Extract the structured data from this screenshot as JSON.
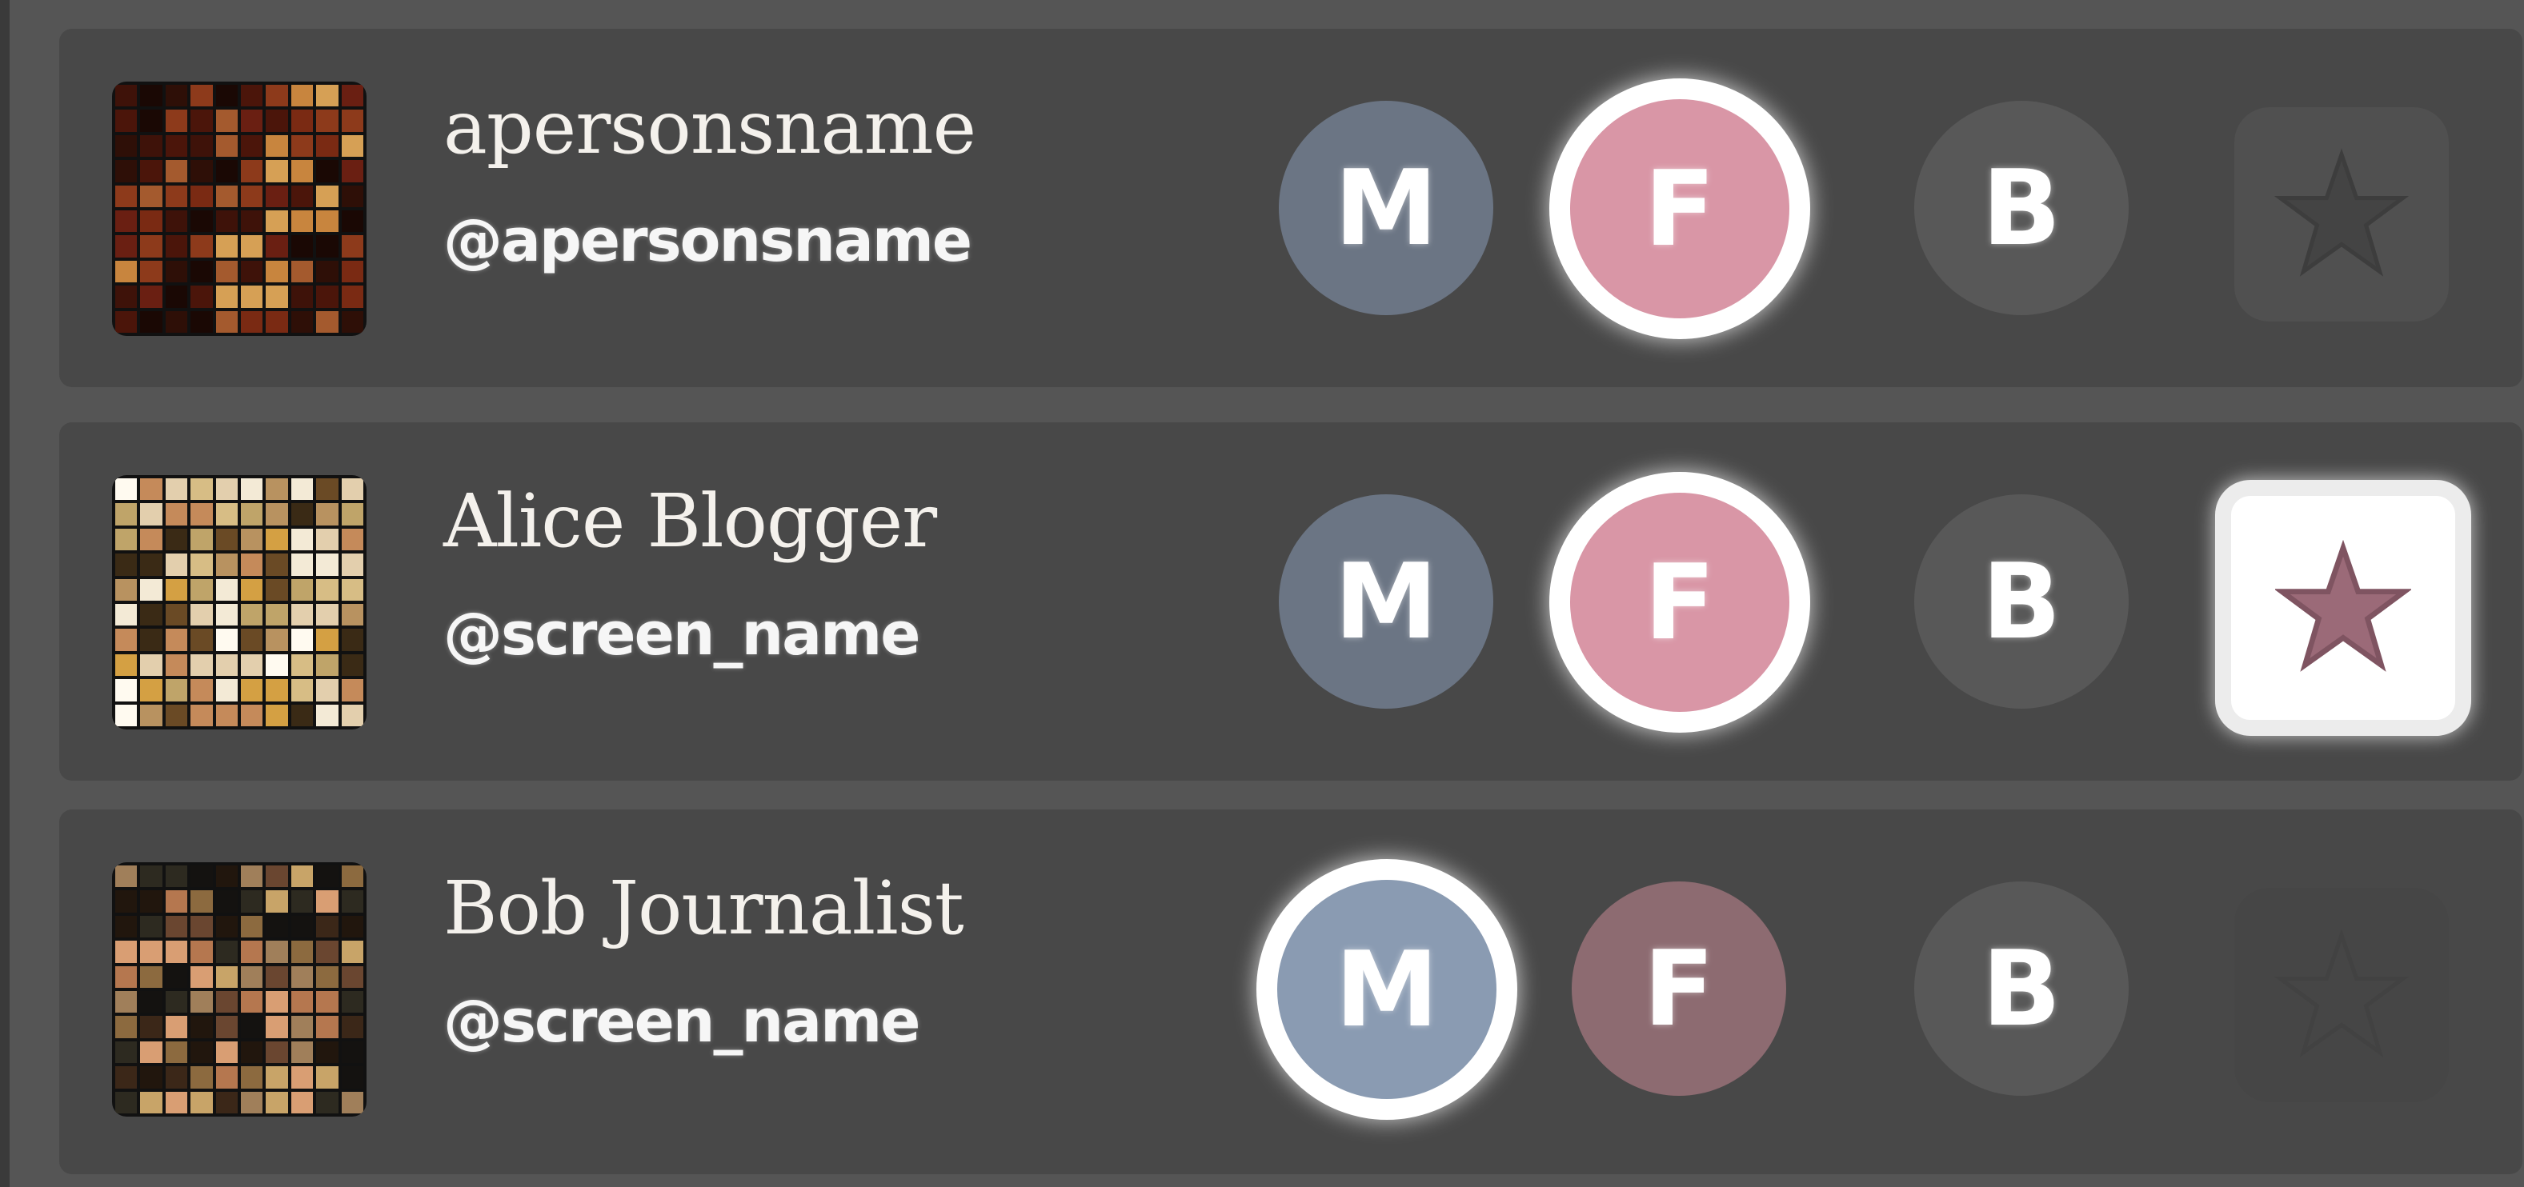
{
  "colors": {
    "male_active": "#8a9bb2",
    "male_inactive": "#6b7584",
    "female_active": "#d996a6",
    "female_inactive": "#8d6b71",
    "both_inactive": "#585858",
    "star_off": "#444444",
    "star_on": "#9b6a78",
    "row_bg": "#484848"
  },
  "accounts": [
    {
      "name": "apersonsname",
      "handle": "@apersonsname",
      "gender_buttons": {
        "m": "M",
        "f": "F",
        "b": "B"
      },
      "selected": "F",
      "favorite": "partially visible",
      "avatar_palette": [
        "#2e0f07",
        "#4b150a",
        "#6a1f12",
        "#8d3a1b",
        "#a45a2e",
        "#c8853e",
        "#d6a055",
        "#7a2a13",
        "#3e1209",
        "#1a0804"
      ]
    },
    {
      "name": "Alice Blogger",
      "handle": "@screen_name",
      "gender_buttons": {
        "m": "M",
        "f": "F",
        "b": "B"
      },
      "selected": "F",
      "favorite": "on",
      "avatar_palette": [
        "#bfa469",
        "#d7bd85",
        "#3a2a15",
        "#c58a5a",
        "#e3cfad",
        "#f3ead6",
        "#d4a043",
        "#6a4a25",
        "#b89260",
        "#fffaf0"
      ]
    },
    {
      "name": "Bob Journalist",
      "handle": "@screen_name",
      "gender_buttons": {
        "m": "M",
        "f": "F",
        "b": "B"
      },
      "selected": "M",
      "favorite": "off",
      "avatar_palette": [
        "#21160d",
        "#3b2718",
        "#6a4630",
        "#b5774f",
        "#d99e73",
        "#8c6a3f",
        "#c8a468",
        "#2d2a20",
        "#141210",
        "#a07f5a"
      ]
    }
  ]
}
